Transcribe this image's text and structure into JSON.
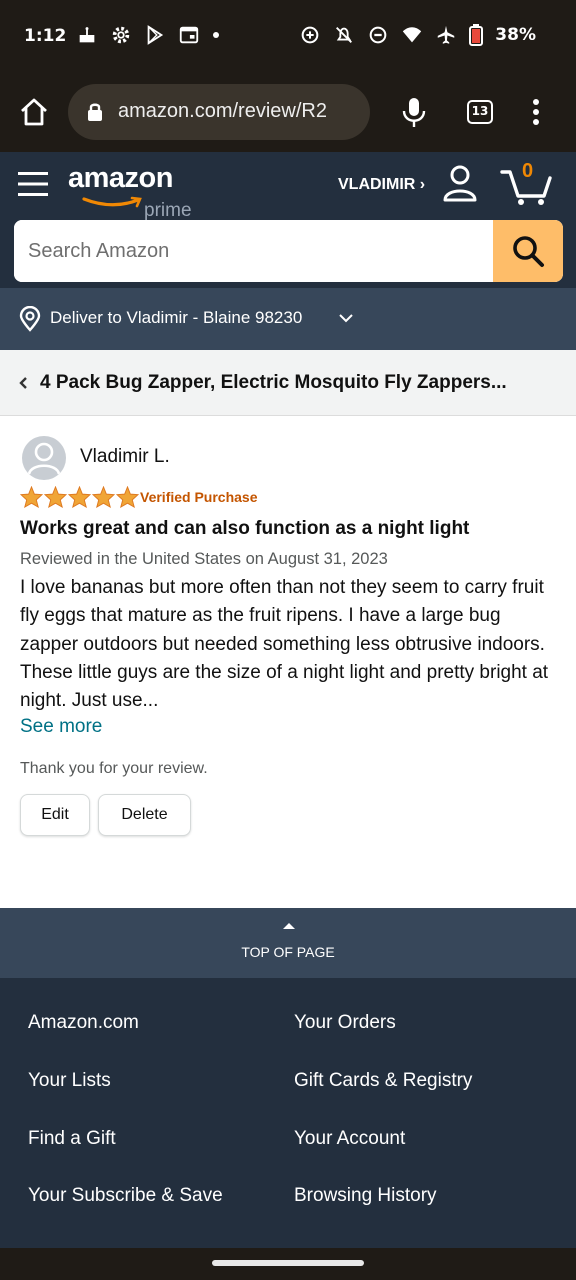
{
  "status_bar": {
    "time": "1:12",
    "battery": "38%"
  },
  "browser": {
    "url": "amazon.com/review/R2",
    "tab_count": "13"
  },
  "header": {
    "logo_text": "amazon",
    "logo_sub": "prime",
    "account_label": "VLADIMIR ›",
    "cart_count": "0",
    "search_placeholder": "Search Amazon"
  },
  "deliver": {
    "text": "Deliver to Vladimir - Blaine 98230"
  },
  "product": {
    "title": "4 Pack Bug Zapper, Electric Mosquito Fly Zappers..."
  },
  "review": {
    "reviewer": "Vladimir L.",
    "rating": 5,
    "verified": "Verified Purchase",
    "title": "Works great and can also function as a night light",
    "date": "Reviewed in the United States on August 31, 2023",
    "body": "I love bananas but more often than not they seem to carry fruit fly eggs that mature as the fruit ripens. I have a large bug zapper outdoors but needed something less obtrusive indoors. These little guys are the size of a night light and pretty bright at night. Just use...",
    "see_more": "See more",
    "thanks": "Thank you for your review.",
    "edit_label": "Edit",
    "delete_label": "Delete"
  },
  "top_of_page": "TOP OF PAGE",
  "footer": {
    "left": [
      "Amazon.com",
      "Your Lists",
      "Find a Gift",
      "Your Subscribe & Save"
    ],
    "right": [
      "Your Orders",
      "Gift Cards & Registry",
      "Your Account",
      "Browsing History"
    ]
  },
  "colors": {
    "header_bg": "#232f3e",
    "deliver_bg": "#37475a",
    "search_button": "#febd69",
    "star": "#f0a536",
    "verified": "#c45500",
    "link": "#007185"
  }
}
